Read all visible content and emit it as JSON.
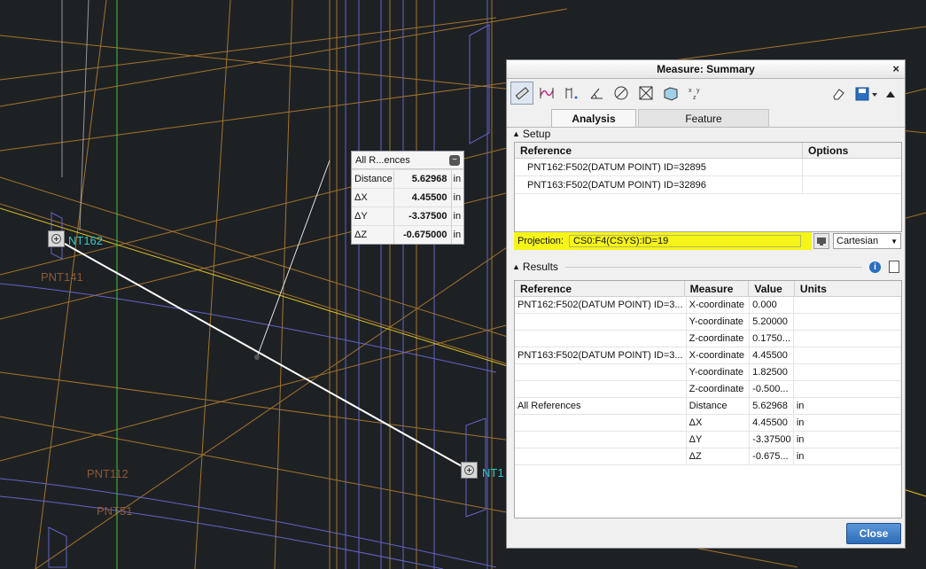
{
  "viewport": {
    "points": [
      {
        "label": "NT162",
        "color": "#2ec8c8"
      },
      {
        "label": "PNT141",
        "color": "#8a5a3a"
      },
      {
        "label": "PNT112",
        "color": "#8a5a3a"
      },
      {
        "label": "PNT51",
        "color": "#8a5a3a"
      },
      {
        "label": "NT1",
        "color": "#2ec8c8"
      }
    ]
  },
  "callout": {
    "title": "All R...ences",
    "rows": [
      {
        "key": "Distance",
        "value": "5.62968",
        "unit": "in"
      },
      {
        "key": "ΔX",
        "value": "4.45500",
        "unit": "in"
      },
      {
        "key": "ΔY",
        "value": "-3.37500",
        "unit": "in"
      },
      {
        "key": "ΔZ",
        "value": "-0.675000",
        "unit": "in"
      }
    ]
  },
  "dialog": {
    "title": "Measure: Summary",
    "tabs": [
      "Analysis",
      "Feature"
    ],
    "setup": {
      "header": "Setup",
      "columns": [
        "Reference",
        "Options"
      ],
      "rows": [
        {
          "reference": "PNT162:F502(DATUM POINT) ID=32895",
          "options": ""
        },
        {
          "reference": "PNT163:F502(DATUM POINT) ID=32896",
          "options": ""
        }
      ],
      "projection_label": "Projection:",
      "projection_value": "CS0:F4(CSYS):ID=19",
      "coord_system": "Cartesian"
    },
    "results": {
      "header": "Results",
      "columns": [
        "Reference",
        "Measure",
        "Value",
        "Units"
      ],
      "rows": [
        {
          "reference": "PNT162:F502(DATUM POINT) ID=3...",
          "measure": "X-coordinate",
          "value": "0.000",
          "units": ""
        },
        {
          "reference": "",
          "measure": "Y-coordinate",
          "value": "5.20000",
          "units": ""
        },
        {
          "reference": "",
          "measure": "Z-coordinate",
          "value": "0.1750...",
          "units": ""
        },
        {
          "reference": "PNT163:F502(DATUM POINT) ID=3...",
          "measure": "X-coordinate",
          "value": "4.45500",
          "units": ""
        },
        {
          "reference": "",
          "measure": "Y-coordinate",
          "value": "1.82500",
          "units": ""
        },
        {
          "reference": "",
          "measure": "Z-coordinate",
          "value": "-0.500...",
          "units": ""
        },
        {
          "reference": "All References",
          "measure": "Distance",
          "value": "5.62968",
          "units": "in"
        },
        {
          "reference": "",
          "measure": "ΔX",
          "value": "4.45500",
          "units": "in"
        },
        {
          "reference": "",
          "measure": "ΔY",
          "value": "-3.37500",
          "units": "in"
        },
        {
          "reference": "",
          "measure": "ΔZ",
          "value": "-0.675...",
          "units": "in"
        }
      ]
    },
    "close_label": "Close"
  }
}
